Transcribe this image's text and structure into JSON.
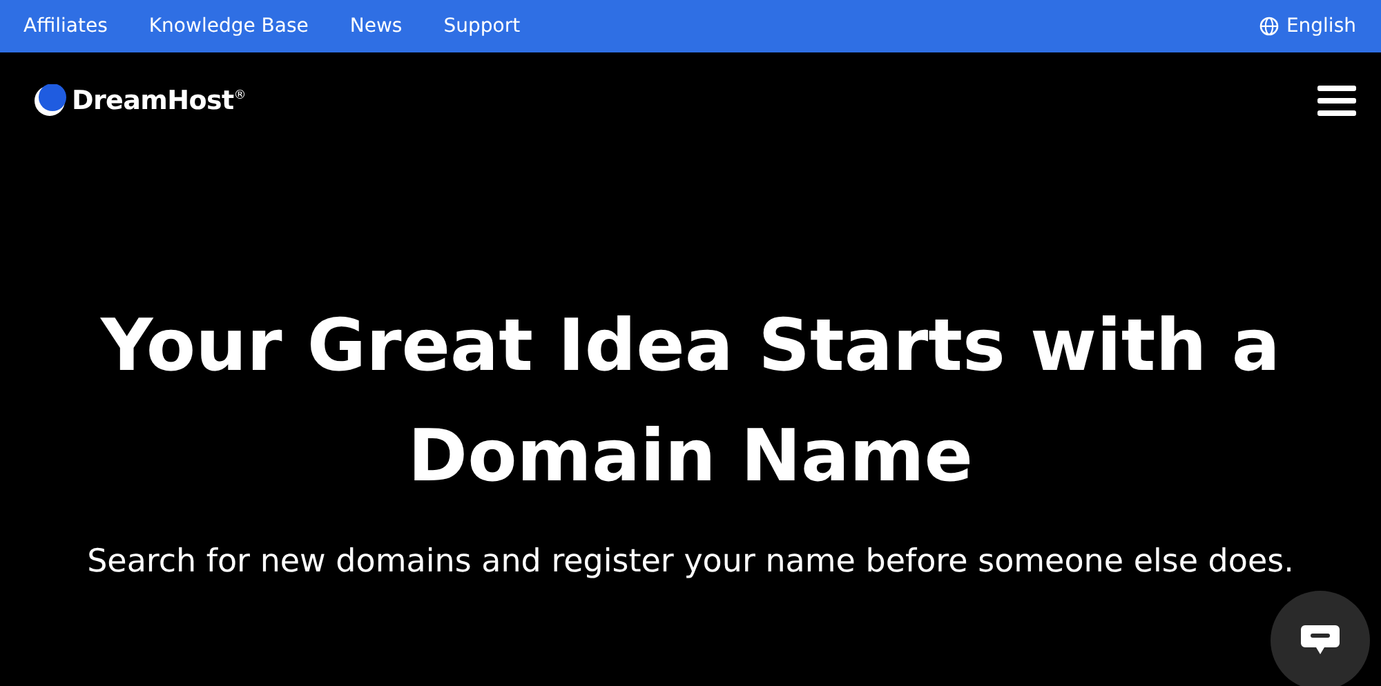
{
  "top_bar": {
    "links": [
      "Affiliates",
      "Knowledge Base",
      "News",
      "Support"
    ],
    "language": "English"
  },
  "header": {
    "logo": "DreamHost",
    "logo_mark": "®"
  },
  "hero": {
    "title": "Your Great Idea Starts with a Domain Name",
    "subtitle": "Search for new domains and register your name before someone else does."
  }
}
